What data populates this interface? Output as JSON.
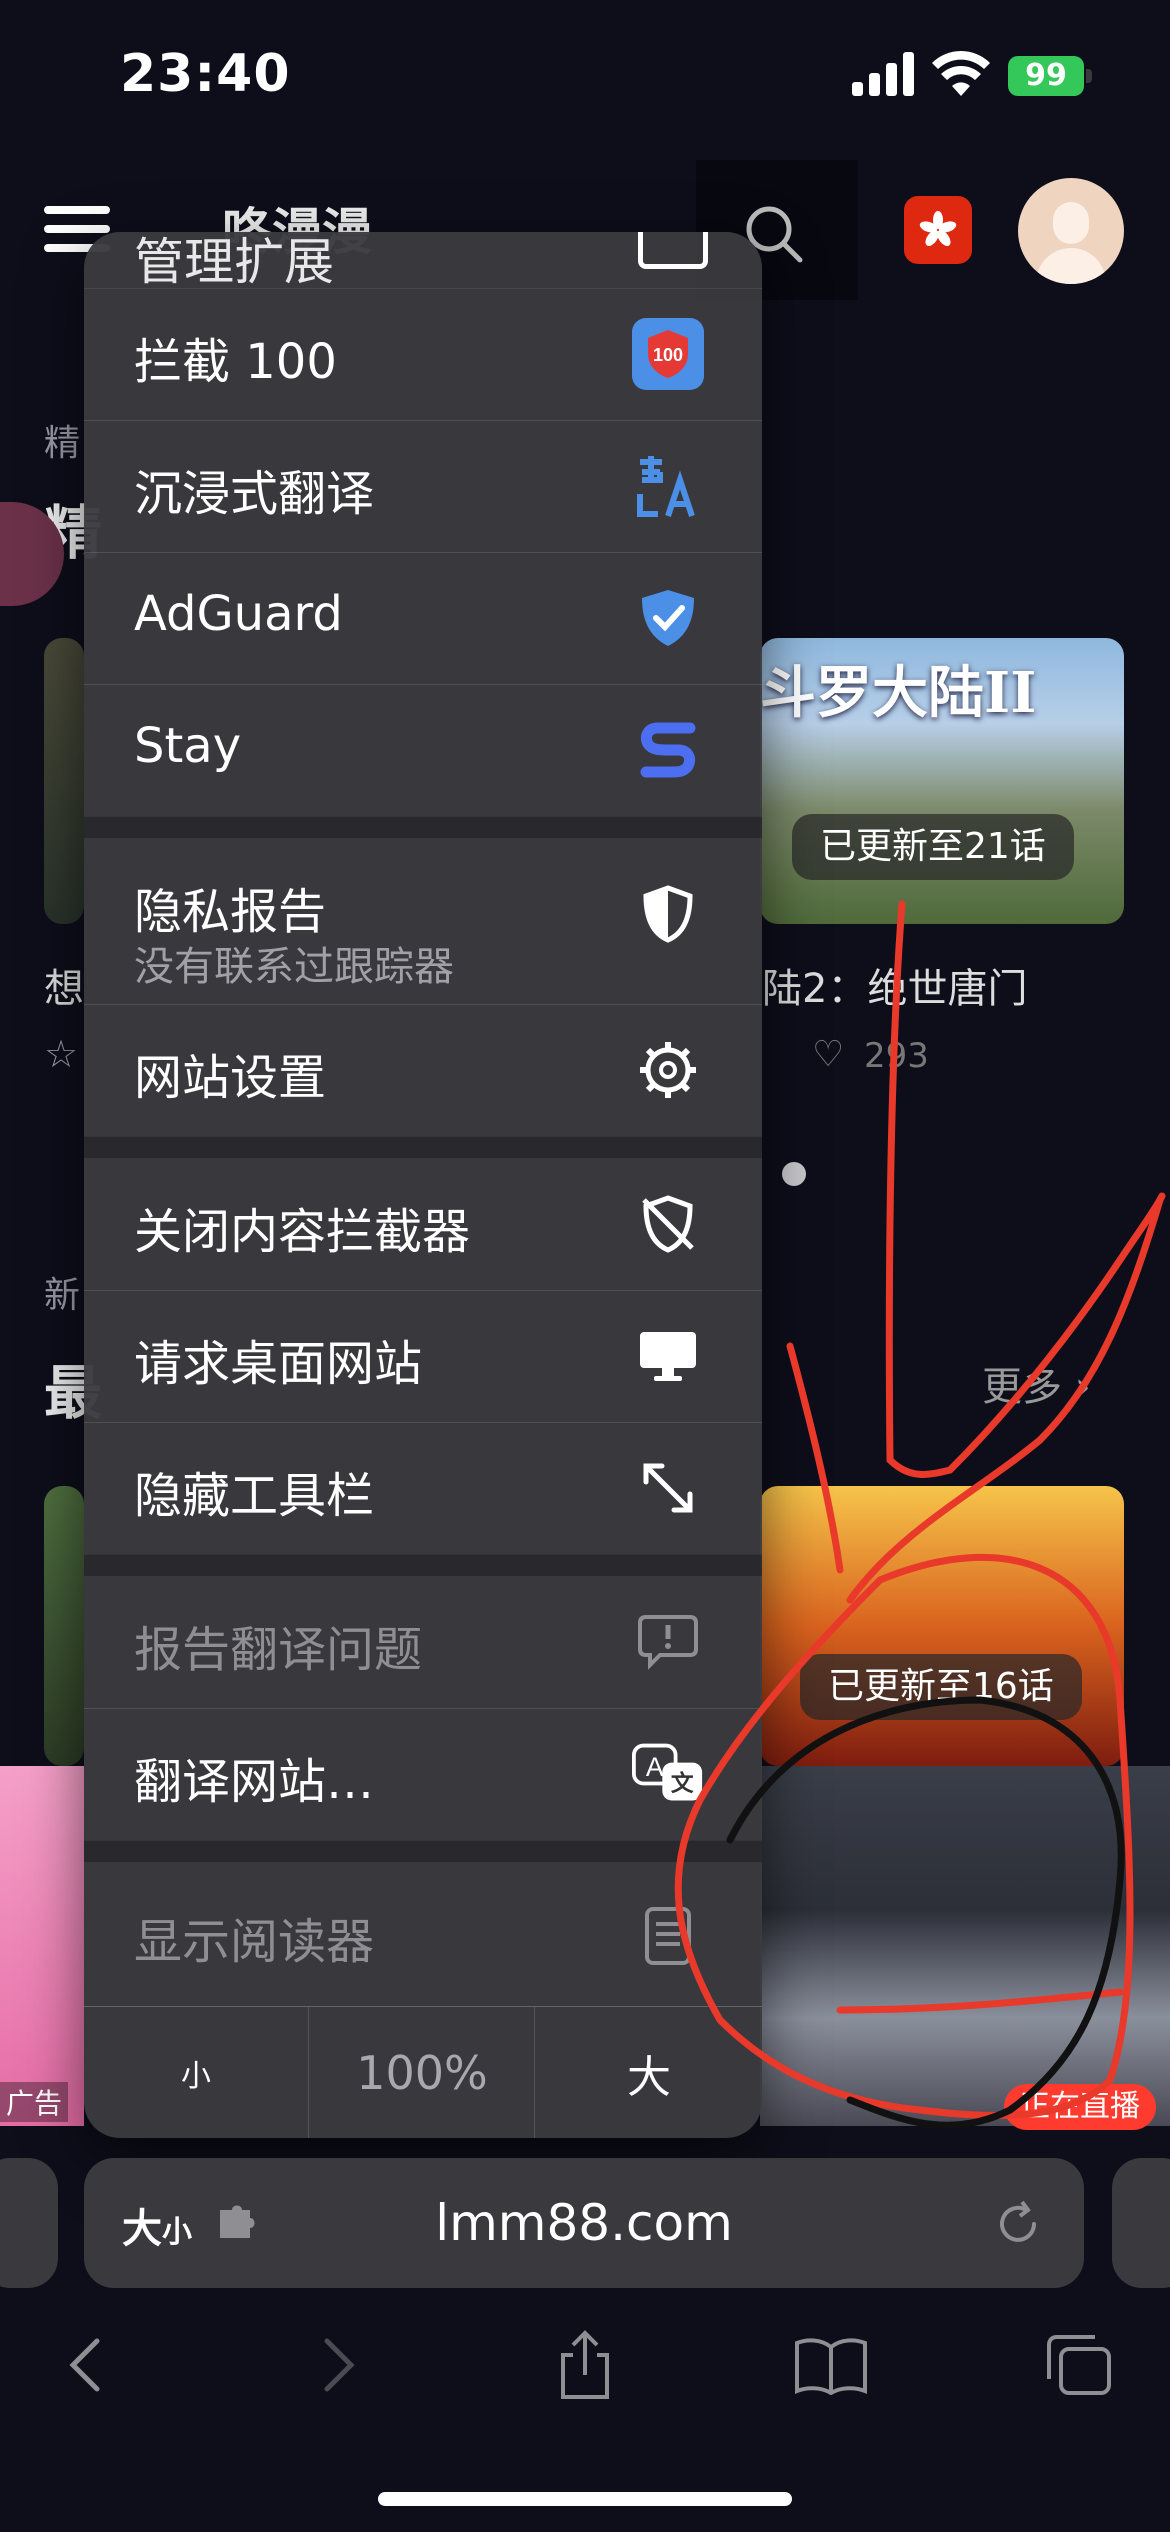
{
  "status_bar": {
    "time": "23:40",
    "battery": "99"
  },
  "site": {
    "title": "咚漫漫",
    "section1_label": "精",
    "section1_title": "精",
    "card_right1_title": "斗罗大陆II",
    "card_right1_badge": "已更新至21话",
    "left_title_fragment": "想",
    "right_title_fragment": "陆2：绝世唐门",
    "likes": "293",
    "section2_label": "新",
    "section2_title": "最",
    "more_label": "更多",
    "card_right2_badge": "已更新至16话",
    "ad_label": "广告",
    "live_label": "正在直播"
  },
  "menu": {
    "cut_item": "管理扩展",
    "items": [
      {
        "label": "拦截 100",
        "icon": "block-100-icon"
      },
      {
        "label": "沉浸式翻译",
        "icon": "immersive-translate-icon"
      },
      {
        "label": "AdGuard",
        "icon": "adguard-shield-icon"
      },
      {
        "label": "Stay",
        "icon": "stay-icon"
      },
      {
        "label": "隐私报告",
        "sublabel": "没有联系过跟踪器",
        "icon": "privacy-shield-icon"
      },
      {
        "label": "网站设置",
        "icon": "gear-icon"
      },
      {
        "label": "关闭内容拦截器",
        "icon": "shield-slash-icon"
      },
      {
        "label": "请求桌面网站",
        "icon": "desktop-icon"
      },
      {
        "label": "隐藏工具栏",
        "icon": "expand-arrows-icon"
      },
      {
        "label": "报告翻译问题",
        "icon": "report-bubble-icon"
      },
      {
        "label": "翻译网站…",
        "icon": "translate-icon"
      },
      {
        "label": "显示阅读器",
        "icon": "reader-icon"
      }
    ],
    "zoom": {
      "smaller": "小",
      "level": "100%",
      "larger": "大"
    }
  },
  "address_bar": {
    "aa_label": "大",
    "aa_small": "小",
    "url": "lmm88.com"
  },
  "colors": {
    "accent_blue": "#3b82f6",
    "scribble_red": "#e8392a",
    "badge_red": "#de2910"
  }
}
